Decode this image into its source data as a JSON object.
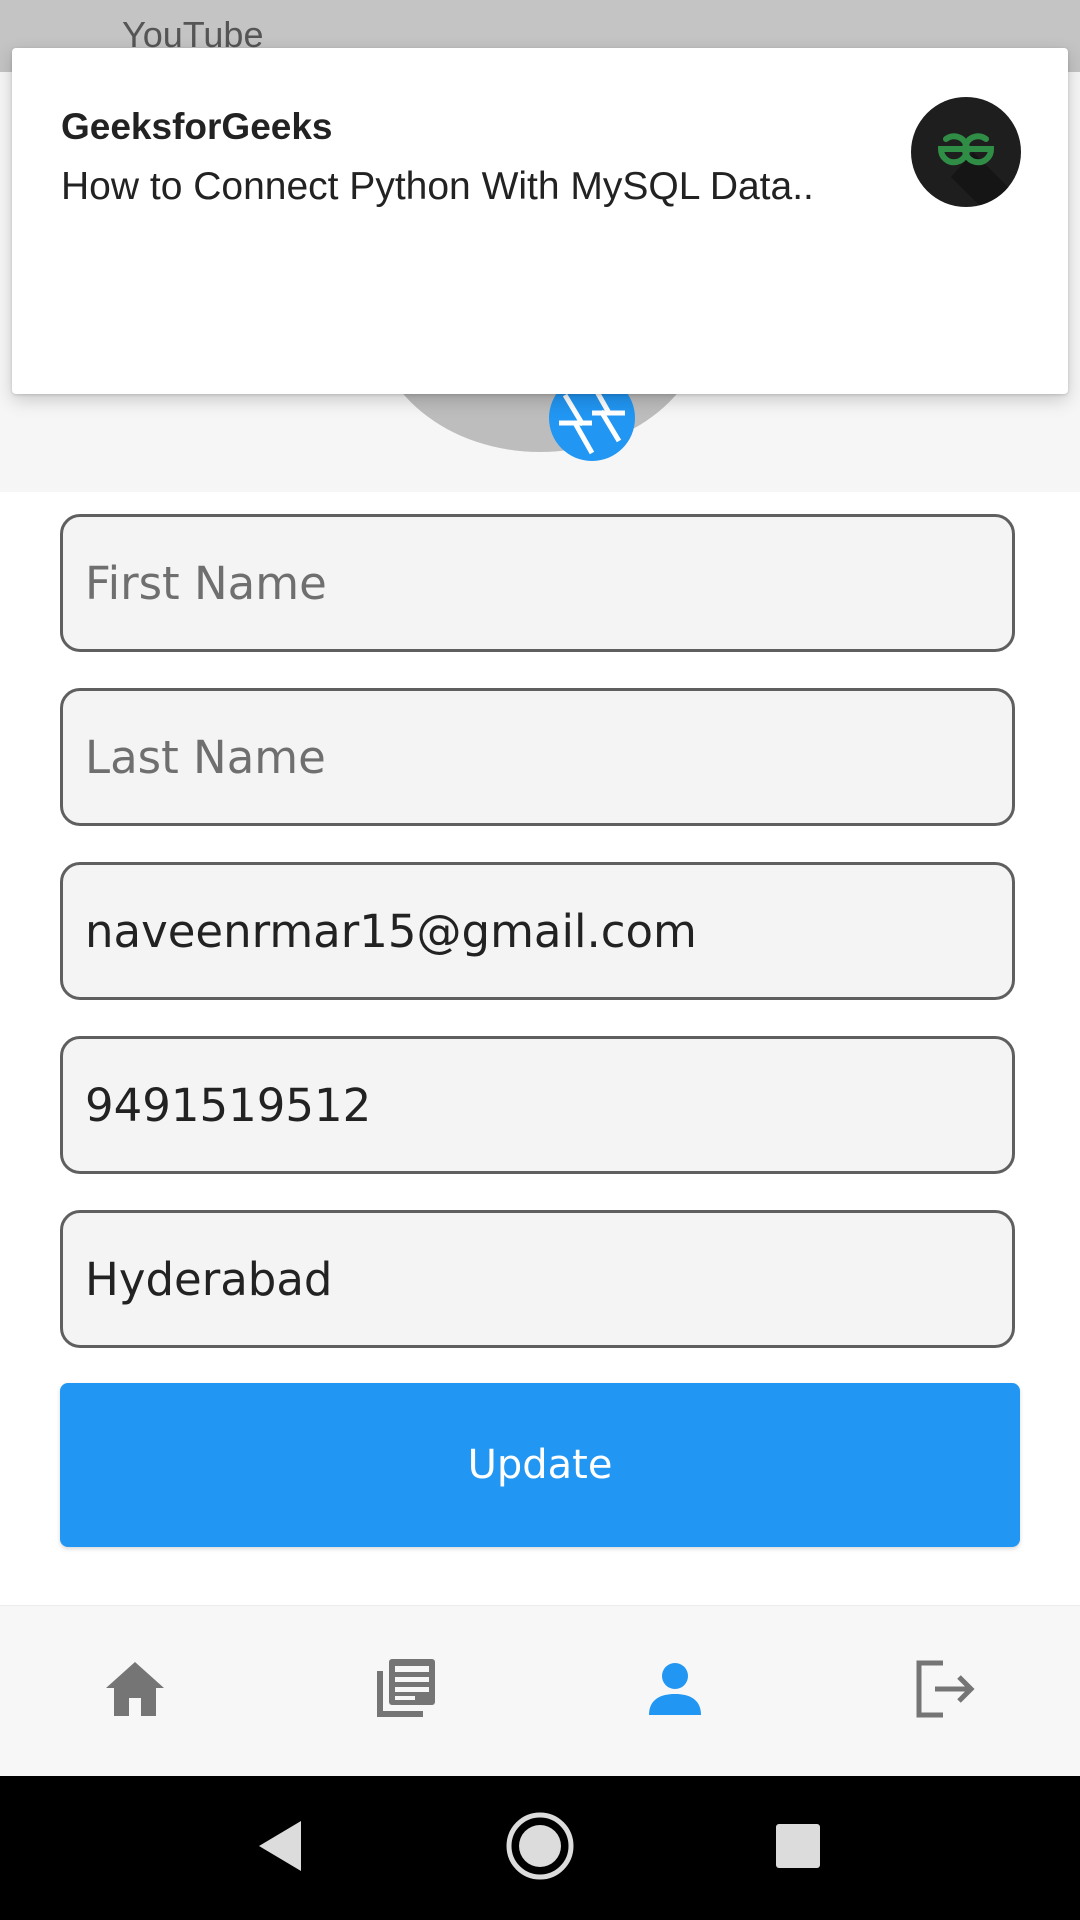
{
  "status_bar": {
    "app_label": "YouTube"
  },
  "notification": {
    "title": "GeeksforGeeks",
    "text": "How to Connect Python With MySQL Data.."
  },
  "form": {
    "first_name": {
      "value": "",
      "placeholder": "First Name"
    },
    "last_name": {
      "value": "",
      "placeholder": "Last Name"
    },
    "email": {
      "value": "naveenrmar15@gmail.com",
      "placeholder": ""
    },
    "phone": {
      "value": "9491519512",
      "placeholder": ""
    },
    "city": {
      "value": "Hyderabad",
      "placeholder": ""
    },
    "update_label": "Update"
  },
  "bottom_nav": {
    "items": [
      {
        "icon": "home-icon",
        "active": false
      },
      {
        "icon": "news-icon",
        "active": false
      },
      {
        "icon": "person-icon",
        "active": true
      },
      {
        "icon": "logout-icon",
        "active": false
      }
    ]
  },
  "system_nav": {
    "buttons": [
      "back-icon",
      "home-circle-icon",
      "recents-icon"
    ]
  },
  "colors": {
    "accent": "#2196f3",
    "nav_icon": "#757575",
    "gfg_green": "#2f8d46"
  }
}
